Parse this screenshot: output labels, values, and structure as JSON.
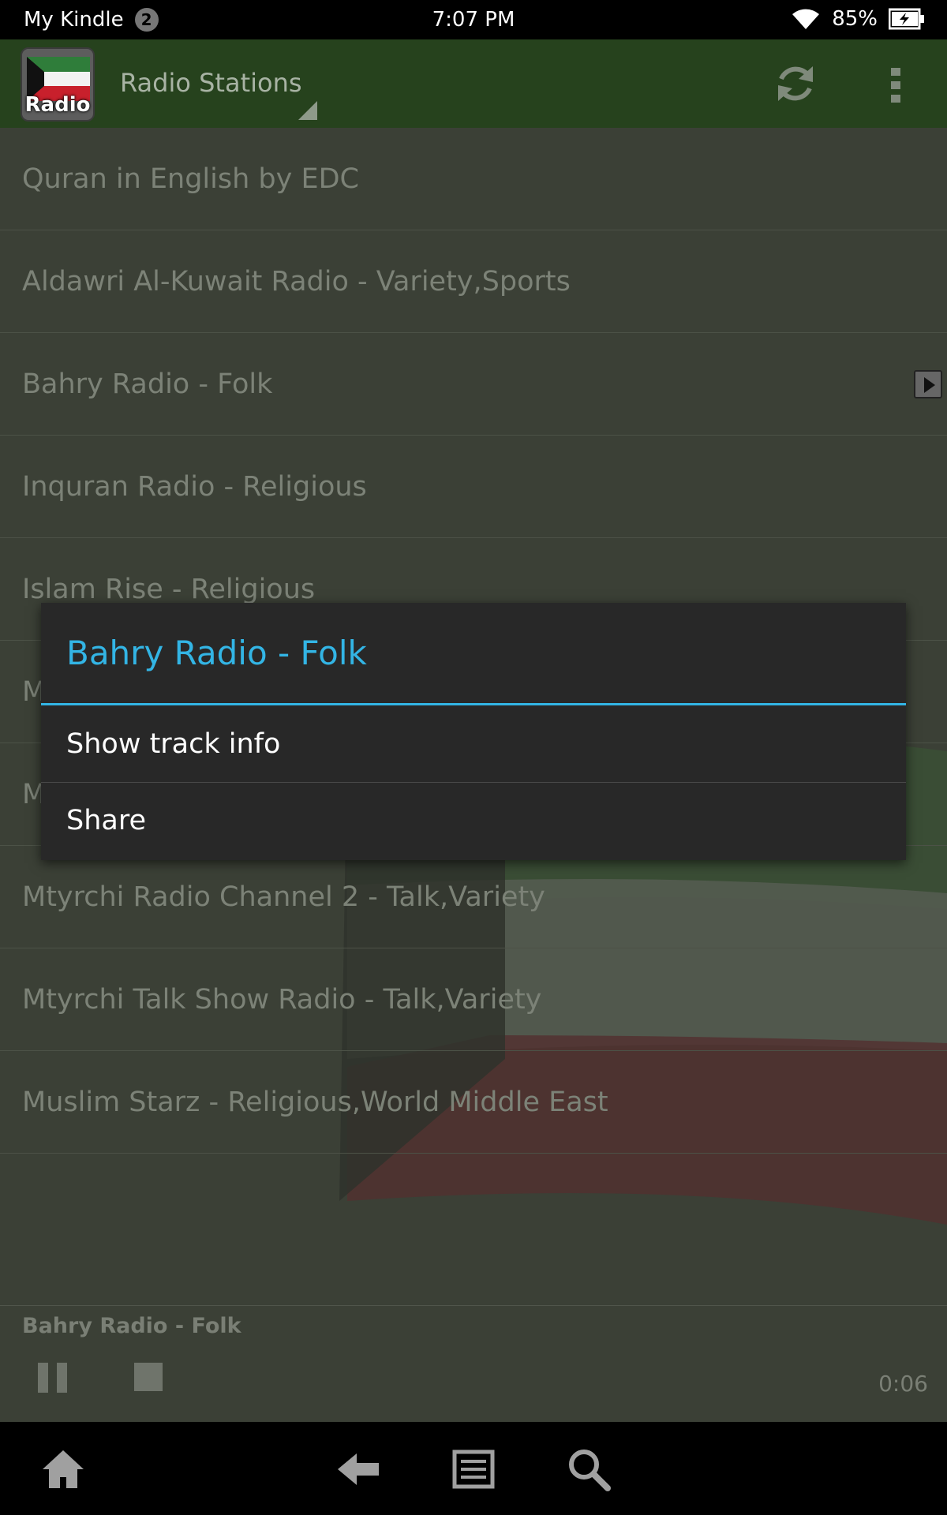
{
  "status_bar": {
    "carrier": "My Kindle",
    "notification_count": "2",
    "time": "7:07 PM",
    "battery": "85%"
  },
  "action_bar": {
    "app_icon_text": "Radio",
    "title": "Radio Stations"
  },
  "stations": [
    {
      "label": "Quran in English by EDC"
    },
    {
      "label": "Aldawri Al-Kuwait Radio - Variety,Sports"
    },
    {
      "label": "Bahry Radio - Folk",
      "playing": true
    },
    {
      "label": "Inquran Radio - Religious"
    },
    {
      "label": "Islam Rise - Religious"
    },
    {
      "label": "M"
    },
    {
      "label": "M"
    },
    {
      "label": "Mtyrchi Radio Channel 2 - Talk,Variety"
    },
    {
      "label": "Mtyrchi Talk Show Radio - Talk,Variety"
    },
    {
      "label": "Muslim Starz - Religious,World Middle East"
    }
  ],
  "now_playing": {
    "title": "Bahry Radio - Folk",
    "elapsed": "0:06"
  },
  "dialog": {
    "title": "Bahry Radio - Folk",
    "items": [
      "Show track info",
      "Share"
    ]
  },
  "colors": {
    "accent": "#33b5e5",
    "action_bar": "#26421d",
    "dialog_bg": "#282828"
  },
  "icons": [
    "wifi-icon",
    "battery-charging-icon",
    "refresh-icon",
    "overflow-menu-icon",
    "pause-icon",
    "stop-icon",
    "home-icon",
    "back-icon",
    "menu-icon",
    "search-icon"
  ]
}
